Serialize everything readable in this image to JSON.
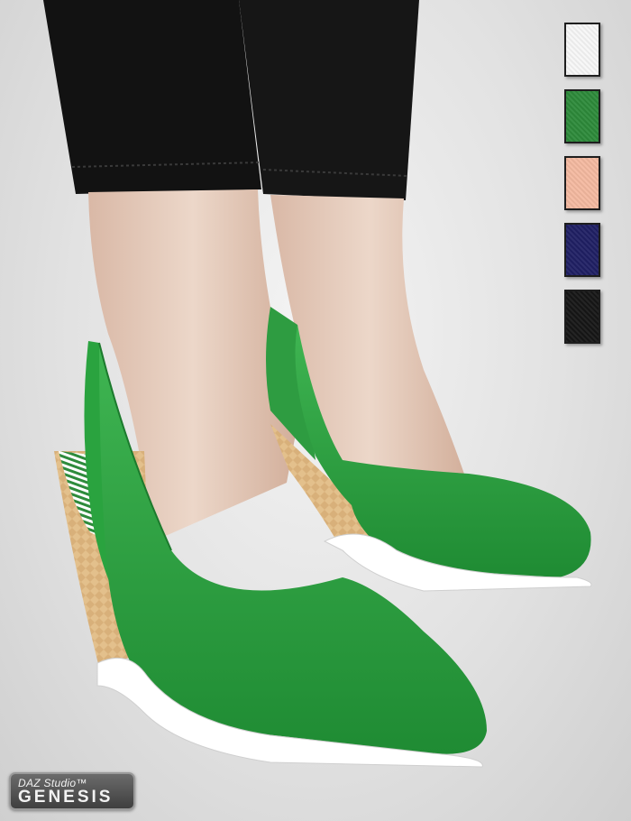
{
  "scene": {
    "description_icon": "green-slingback-wedge-shoes"
  },
  "swatches": [
    {
      "name": "white",
      "color": "#f7f7f7"
    },
    {
      "name": "green",
      "color": "#2d8a3a"
    },
    {
      "name": "peach",
      "color": "#f4b9a0"
    },
    {
      "name": "navy",
      "color": "#202064"
    },
    {
      "name": "black",
      "color": "#161616"
    }
  ],
  "badge": {
    "line1": "DAZ Studio™",
    "line2": "GENESIS"
  }
}
